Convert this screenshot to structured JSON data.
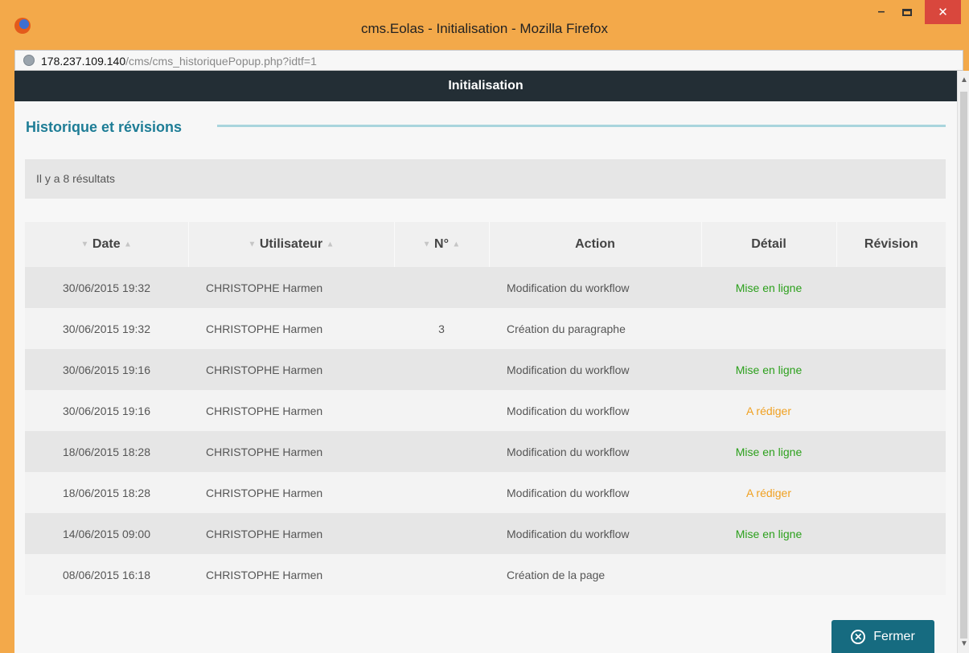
{
  "window": {
    "title": "cms.Eolas - Initialisation - Mozilla Firefox",
    "close_glyph": "✕",
    "minimize_glyph": "–"
  },
  "address": {
    "host": "178.237.109.140",
    "path": "/cms/cms_historiquePopup.php?idtf=1"
  },
  "page": {
    "header": "Initialisation",
    "section_title": "Historique et révisions",
    "results": "Il y a 8 résultats",
    "columns": {
      "date": "Date",
      "user": "Utilisateur",
      "num": "N°",
      "action": "Action",
      "detail": "Détail",
      "revision": "Révision"
    },
    "rows": [
      {
        "date": "30/06/2015 19:32",
        "user": "CHRISTOPHE Harmen",
        "num": "",
        "action": "Modification du workflow",
        "detail": "Mise en ligne",
        "revision": ""
      },
      {
        "date": "30/06/2015 19:32",
        "user": "CHRISTOPHE Harmen",
        "num": "3",
        "action": "Création du paragraphe",
        "detail": "",
        "revision": ""
      },
      {
        "date": "30/06/2015 19:16",
        "user": "CHRISTOPHE Harmen",
        "num": "",
        "action": "Modification du workflow",
        "detail": "Mise en ligne",
        "revision": ""
      },
      {
        "date": "30/06/2015 19:16",
        "user": "CHRISTOPHE Harmen",
        "num": "",
        "action": "Modification du workflow",
        "detail": "A rédiger",
        "revision": ""
      },
      {
        "date": "18/06/2015 18:28",
        "user": "CHRISTOPHE Harmen",
        "num": "",
        "action": "Modification du workflow",
        "detail": "Mise en ligne",
        "revision": ""
      },
      {
        "date": "18/06/2015 18:28",
        "user": "CHRISTOPHE Harmen",
        "num": "",
        "action": "Modification du workflow",
        "detail": "A rédiger",
        "revision": ""
      },
      {
        "date": "14/06/2015 09:00",
        "user": "CHRISTOPHE Harmen",
        "num": "",
        "action": "Modification du workflow",
        "detail": "Mise en ligne",
        "revision": ""
      },
      {
        "date": "08/06/2015 16:18",
        "user": "CHRISTOPHE Harmen",
        "num": "",
        "action": "Création de la page",
        "detail": "",
        "revision": ""
      }
    ],
    "close_button": "Fermer"
  },
  "colors": {
    "mise_en_ligne": "#2ca01c",
    "a_rediger": "#f0a020",
    "accent": "#1e7d96"
  }
}
